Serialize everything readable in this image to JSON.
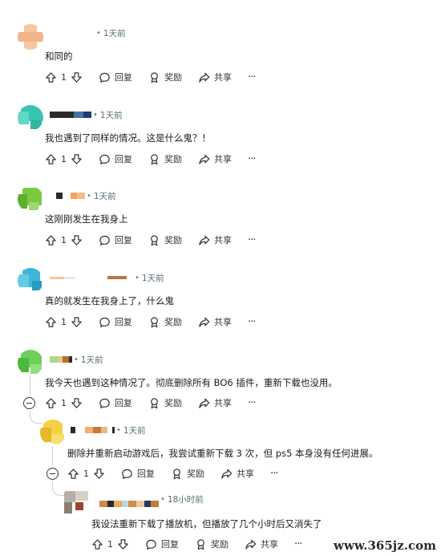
{
  "comments": [
    {
      "time": "1天前",
      "text": "和同的",
      "votes": "1"
    },
    {
      "time": "1天前",
      "text": "我也遇到了同样的情况。这是什么鬼？！",
      "votes": "1"
    },
    {
      "time": "1天前",
      "text": "这刚刚发生在我身上",
      "votes": "1"
    },
    {
      "time": "1天前",
      "text": "真的就发生在我身上了，什么鬼",
      "votes": "1"
    },
    {
      "time": "1天前",
      "text": "我今天也遇到这种情况了。彻底删除所有 BO6 插件，重新下载也没用。",
      "votes": "1"
    },
    {
      "time": "1天前",
      "text": "删除并重新启动游戏后，我尝试重新下载 3 次，但 ps5 本身没有任何进展。",
      "votes": "1"
    },
    {
      "time": "18小时前",
      "text": "我设法重新下载了播放机，但播放了几个小时后又消失了",
      "votes": "1"
    }
  ],
  "actions": {
    "reply": "回复",
    "award": "奖励",
    "share": "共享",
    "more": "···"
  },
  "watermark": "www.365jz.com"
}
